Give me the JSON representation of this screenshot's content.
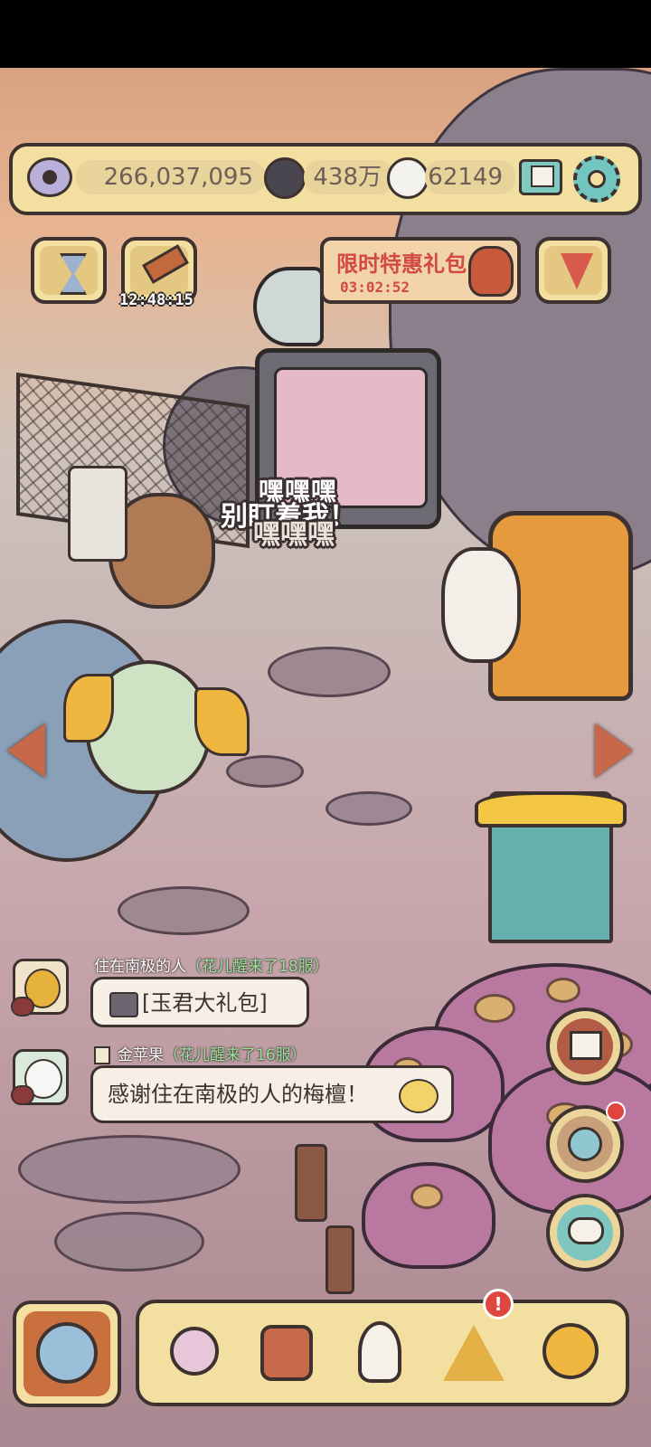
{
  "currency": {
    "eyes": "266,037,095",
    "dark_orbs": "438万",
    "ghost_orbs": "62149"
  },
  "icons": {
    "eye": "eye-icon",
    "dark_orb": "dark-orb-icon",
    "ghost_orb": "ghost-orb-icon",
    "mail": "mail-icon",
    "settings": "gear-icon",
    "hourglass": "hourglass-icon",
    "auction": "gavel-icon",
    "party": "party-popper-icon"
  },
  "auction_timer": "12:48:15",
  "promo": {
    "title": "限时特惠礼包",
    "countdown": "03:02:52"
  },
  "scene_text": {
    "laugh": "嘿嘿嘿",
    "dont_look": "别盯着我！",
    "laugh_dark": "嘿嘿嘿"
  },
  "chat": [
    {
      "name": "住在南极的人",
      "server": "（花儿醒来了18服）",
      "message": "[玉君大礼包]"
    },
    {
      "name": "金苹果",
      "server": "（花儿醒来了16服）",
      "message": "感谢住在南极的人的梅檀！"
    }
  ],
  "bottom_nav": [
    "snail-icon",
    "backpack-icon",
    "statue-bust-icon",
    "pyramid-eye-icon",
    "magnifier-key-icon"
  ],
  "colors": {
    "panel": "#f3dfa0",
    "outline": "#3d3230",
    "promo_red": "#d24a44",
    "notify_red": "#e04640"
  }
}
